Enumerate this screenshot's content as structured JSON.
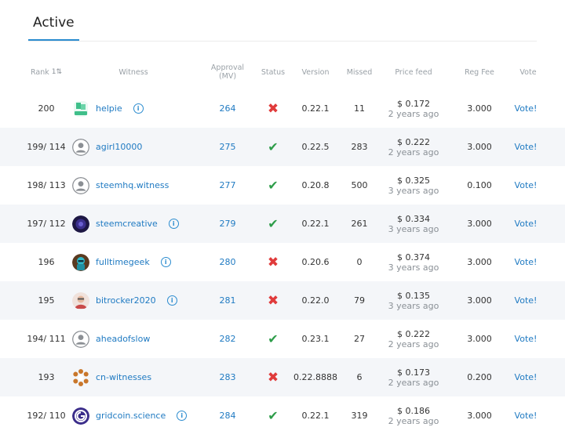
{
  "tabs": {
    "active": "Active"
  },
  "columns": {
    "rank": "Rank",
    "rank_sort_icon": "sort-icon",
    "witness": "Witness",
    "approval_line1": "Approval",
    "approval_line2": "(MV)",
    "status": "Status",
    "version": "Version",
    "missed": "Missed",
    "price_feed": "Price feed",
    "reg_fee": "Reg Fee",
    "vote": "Vote"
  },
  "colors": {
    "link": "#1f7ac2",
    "accent": "#2b8ccf",
    "inactive": "#e03b3b",
    "active": "#2e9d4a",
    "row_shade": "#f4f6f9"
  },
  "rows": [
    {
      "rank": "200",
      "name": "helpie",
      "avatar": "helpie-logo",
      "info": true,
      "approval": "264",
      "status": "inactive",
      "version": "0.22.1",
      "missed": "11",
      "price": "$ 0.172",
      "ago": "2 years ago",
      "reg_fee": "3.000",
      "vote": "Vote!"
    },
    {
      "rank": "199/ 114",
      "name": "agirl10000",
      "avatar": "default",
      "info": false,
      "approval": "275",
      "status": "active",
      "version": "0.22.5",
      "missed": "283",
      "price": "$ 0.222",
      "ago": "2 years ago",
      "reg_fee": "3.000",
      "vote": "Vote!"
    },
    {
      "rank": "198/ 113",
      "name": "steemhq.witness",
      "avatar": "default",
      "info": false,
      "approval": "277",
      "status": "active",
      "version": "0.20.8",
      "missed": "500",
      "price": "$ 0.325",
      "ago": "3 years ago",
      "reg_fee": "0.100",
      "vote": "Vote!"
    },
    {
      "rank": "197/ 112",
      "name": "steemcreative",
      "avatar": "dark-purple",
      "info": true,
      "approval": "279",
      "status": "active",
      "version": "0.22.1",
      "missed": "261",
      "price": "$ 0.334",
      "ago": "3 years ago",
      "reg_fee": "3.000",
      "vote": "Vote!"
    },
    {
      "rank": "196",
      "name": "fulltimegeek",
      "avatar": "geek",
      "info": true,
      "approval": "280",
      "status": "inactive",
      "version": "0.20.6",
      "missed": "0",
      "price": "$ 0.374",
      "ago": "3 years ago",
      "reg_fee": "3.000",
      "vote": "Vote!"
    },
    {
      "rank": "195",
      "name": "bitrocker2020",
      "avatar": "person",
      "info": true,
      "approval": "281",
      "status": "inactive",
      "version": "0.22.0",
      "missed": "79",
      "price": "$ 0.135",
      "ago": "3 years ago",
      "reg_fee": "3.000",
      "vote": "Vote!"
    },
    {
      "rank": "194/ 111",
      "name": "aheadofslow",
      "avatar": "default",
      "info": false,
      "approval": "282",
      "status": "active",
      "version": "0.23.1",
      "missed": "27",
      "price": "$ 0.222",
      "ago": "2 years ago",
      "reg_fee": "3.000",
      "vote": "Vote!"
    },
    {
      "rank": "193",
      "name": "cn-witnesses",
      "avatar": "cn-ring",
      "info": false,
      "approval": "283",
      "status": "inactive",
      "version": "0.22.8888",
      "missed": "6",
      "price": "$ 0.173",
      "ago": "2 years ago",
      "reg_fee": "0.200",
      "vote": "Vote!"
    },
    {
      "rank": "192/ 110",
      "name": "gridcoin.science",
      "avatar": "gridcoin",
      "info": true,
      "approval": "284",
      "status": "active",
      "version": "0.22.1",
      "missed": "319",
      "price": "$ 0.186",
      "ago": "2 years ago",
      "reg_fee": "3.000",
      "vote": "Vote!"
    }
  ]
}
